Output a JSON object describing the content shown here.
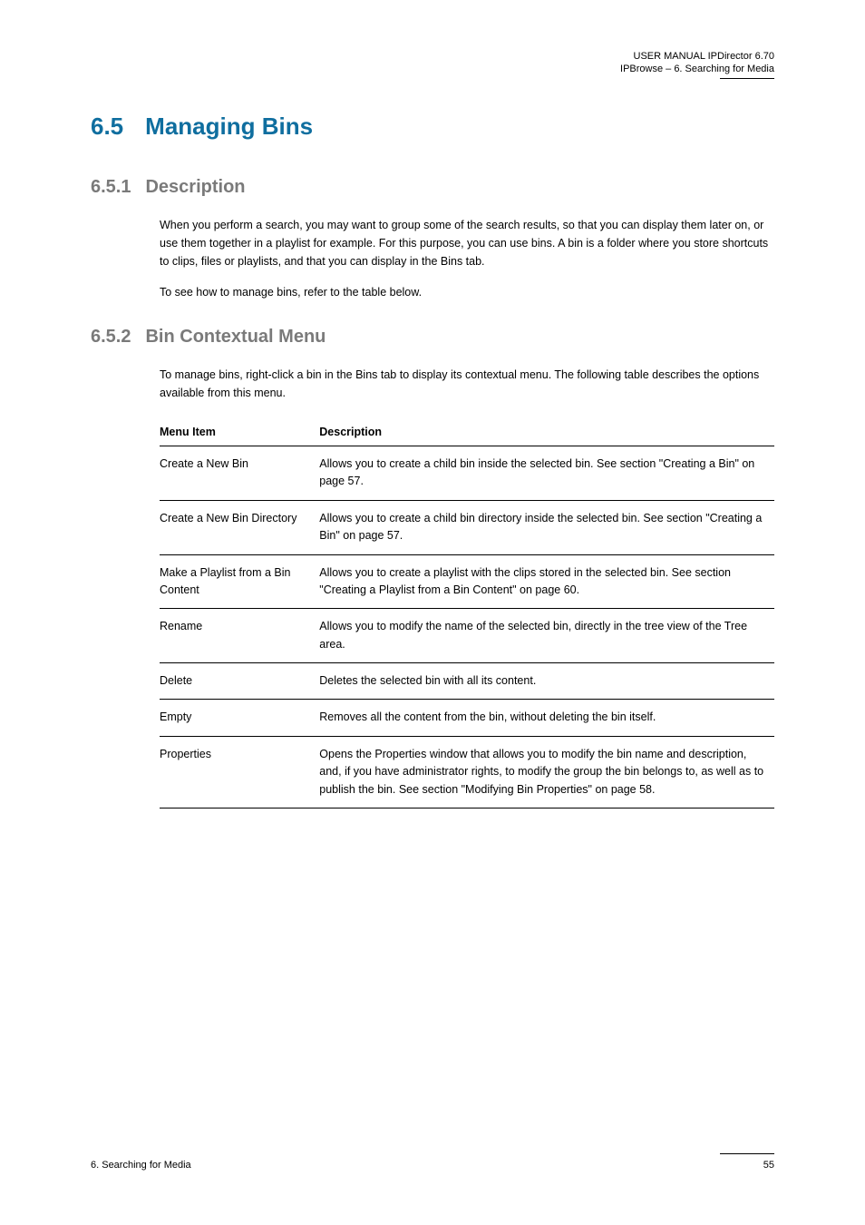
{
  "header": {
    "line1": "USER MANUAL IPDirector 6.70",
    "line2": "IPBrowse – 6. Searching for Media"
  },
  "section": {
    "number": "6.5",
    "title": "Managing Bins"
  },
  "sub1": {
    "number": "6.5.1",
    "title": "Description",
    "para1": "When you perform a search, you may want to group some of the search results, so that you can display them later on, or use them together in a playlist for example. For this purpose, you can use bins. A bin is a folder where you store shortcuts to clips, files or playlists, and that you can display in the Bins tab.",
    "para2": "To see how to manage bins, refer to the table below."
  },
  "sub2": {
    "number": "6.5.2",
    "title": "Bin Contextual Menu",
    "intro": "To manage bins, right-click a bin in the Bins tab to display its contextual menu. The following table describes the options available from this menu.",
    "table": {
      "headers": [
        "Menu Item",
        "Description"
      ],
      "rows": [
        {
          "item": "Create a New Bin",
          "desc": "Allows you to create a child bin inside the selected bin. See section \"Creating a Bin\" on page 57."
        },
        {
          "item": "Create a New Bin Directory",
          "desc": "Allows you to create a child bin directory inside the selected bin. See section \"Creating a Bin\" on page 57."
        },
        {
          "item": "Make a Playlist from a Bin Content",
          "desc": "Allows you to create a playlist with the clips stored in the selected bin. See section \"Creating a Playlist from a Bin Content\" on page 60."
        },
        {
          "item": "Rename",
          "desc": "Allows you to modify the name of the selected bin, directly in the tree view of the Tree area."
        },
        {
          "item": "Delete",
          "desc": "Deletes the selected bin with all its content."
        },
        {
          "item": "Empty",
          "desc": "Removes all the content from the bin, without deleting the bin itself."
        },
        {
          "item": "Properties",
          "desc": "Opens the Properties window that allows you to modify the bin name and description, and, if you have administrator rights, to modify the group the bin belongs to, as well as to publish the bin. See section \"Modifying Bin Properties\" on page 58."
        }
      ]
    }
  },
  "footer": {
    "left": "6. Searching for Media",
    "right": "55"
  }
}
